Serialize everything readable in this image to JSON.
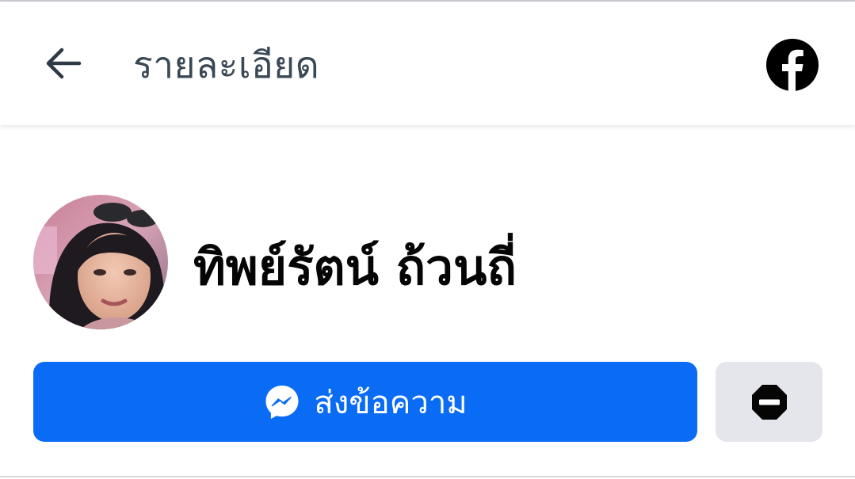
{
  "header": {
    "title": "รายละเอียด",
    "back_icon": "arrow-left-icon",
    "logo_icon": "facebook-logo-icon"
  },
  "profile": {
    "name": "ทิพย์รัตน์ ถ้วนถี่",
    "avatar_icon": "profile-photo"
  },
  "actions": {
    "message_label": "ส่งข้อความ",
    "message_icon": "messenger-icon",
    "block_icon": "block-icon"
  },
  "colors": {
    "primary": "#0a6cf5",
    "secondary_button": "#e4e6eb",
    "title_text": "#3a4755",
    "name_text": "#050505"
  }
}
